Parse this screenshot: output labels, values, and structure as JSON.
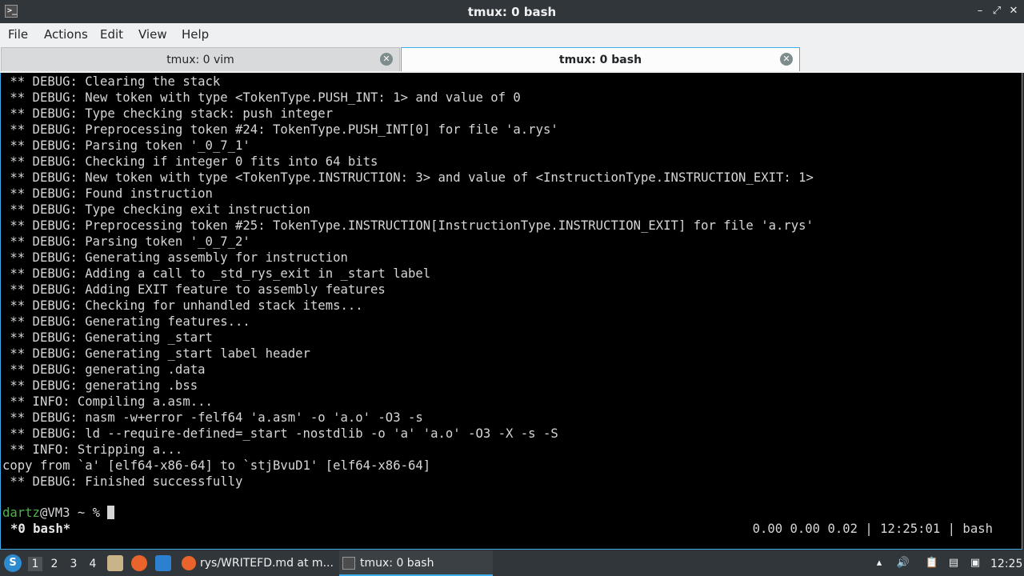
{
  "window": {
    "title": "tmux: 0 bash",
    "icon": "terminal-icon"
  },
  "menu": [
    "File",
    "Actions",
    "Edit",
    "View",
    "Help"
  ],
  "tabs": [
    {
      "label": "tmux: 0 vim"
    },
    {
      "label": "tmux: 0 bash"
    }
  ],
  "terminal": {
    "lines": [
      " ** DEBUG: Clearing the stack",
      " ** DEBUG: New token with type <TokenType.PUSH_INT: 1> and value of 0",
      " ** DEBUG: Type checking stack: push integer",
      " ** DEBUG: Preprocessing token #24: TokenType.PUSH_INT[0] for file 'a.rys'",
      " ** DEBUG: Parsing token '_0_7_1'",
      " ** DEBUG: Checking if integer 0 fits into 64 bits",
      " ** DEBUG: New token with type <TokenType.INSTRUCTION: 3> and value of <InstructionType.INSTRUCTION_EXIT: 1>",
      " ** DEBUG: Found instruction",
      " ** DEBUG: Type checking exit instruction",
      " ** DEBUG: Preprocessing token #25: TokenType.INSTRUCTION[InstructionType.INSTRUCTION_EXIT] for file 'a.rys'",
      " ** DEBUG: Parsing token '_0_7_2'",
      " ** DEBUG: Generating assembly for instruction",
      " ** DEBUG: Adding a call to _std_rys_exit in _start label",
      " ** DEBUG: Adding EXIT feature to assembly features",
      " ** DEBUG: Checking for unhandled stack items...",
      " ** DEBUG: Generating features...",
      " ** DEBUG: Generating _start",
      " ** DEBUG: Generating _start label header",
      " ** DEBUG: generating .data",
      " ** DEBUG: generating .bss",
      " ** INFO: Compiling a.asm...",
      " ** DEBUG: nasm -w+error -felf64 'a.asm' -o 'a.o' -O3 -s",
      " ** DEBUG: ld --require-defined=_start -nostdlib -o 'a' 'a.o' -O3 -X -s -S",
      " ** INFO: Stripping a...",
      "copy from `a' [elf64-x86-64] to `stjBvuD1' [elf64-x86-64]",
      " ** DEBUG: Finished successfully"
    ],
    "prompt_user": "dartz",
    "prompt_rest": "@VM3 ~ % ",
    "status_left": "*0 bash*",
    "status_right": "0.00 0.00 0.02 | 12:25:01 | bash"
  },
  "taskbar": {
    "desktops": [
      "1",
      "2",
      "3",
      "4"
    ],
    "tasks": [
      {
        "label": "rys/WRITEFD.md at m...",
        "icon": "firefox-icon"
      },
      {
        "label": "tmux: 0 bash",
        "icon": "terminal-icon"
      }
    ],
    "clock": "12:25"
  }
}
